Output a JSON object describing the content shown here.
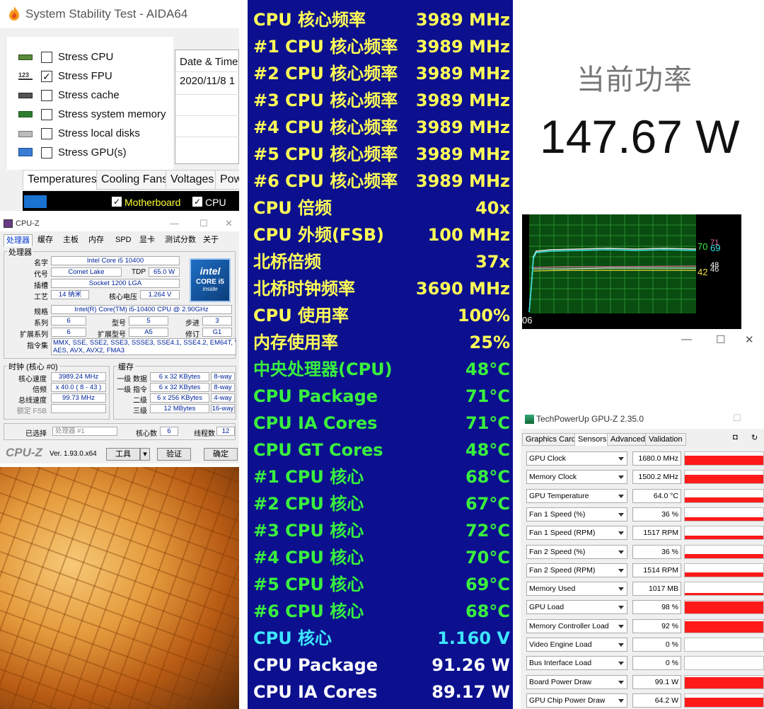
{
  "aida": {
    "title": "System Stability Test - AIDA64",
    "options": [
      {
        "label": "Stress CPU",
        "checked": false,
        "icon": "cpu-chip-icon"
      },
      {
        "label": "Stress FPU",
        "checked": true,
        "icon": "fpu-123-icon"
      },
      {
        "label": "Stress cache",
        "checked": false,
        "icon": "cache-chip-icon"
      },
      {
        "label": "Stress system memory",
        "checked": false,
        "icon": "memory-module-icon"
      },
      {
        "label": "Stress local disks",
        "checked": false,
        "icon": "disk-drive-icon"
      },
      {
        "label": "Stress GPU(s)",
        "checked": false,
        "icon": "monitor-gpu-icon"
      }
    ],
    "date_header": "Date & Time",
    "date_value": "2020/11/8 1",
    "tabs": [
      "Temperatures",
      "Cooling Fans",
      "Voltages",
      "Pow"
    ],
    "graph_checks": [
      "Motherboard",
      "CPU"
    ]
  },
  "cpuz": {
    "title": "CPU-Z",
    "tabs": [
      "处理器",
      "缓存",
      "主板",
      "内存",
      "SPD",
      "显卡",
      "测试分数",
      "关于"
    ],
    "group_processor": "处理器",
    "labels": {
      "name": "名字",
      "codename": "代号",
      "tdp": "TDP",
      "package": "插槽",
      "tech": "工艺",
      "voltage": "核心电压",
      "spec": "规格",
      "family": "系列",
      "model": "型号",
      "stepping": "步进",
      "ext_family": "扩展系列",
      "ext_model": "扩展型号",
      "revision": "修订",
      "instructions": "指令集"
    },
    "values": {
      "name": "Intel Core i5 10400",
      "codename": "Comet Lake",
      "tdp": "65.0 W",
      "package": "Socket 1200 LGA",
      "tech": "14 纳米",
      "voltage": "1.264 V",
      "spec": "Intel(R) Core(TM) i5-10400 CPU @ 2.90GHz",
      "family": "6",
      "model": "5",
      "stepping": "3",
      "ext_family": "6",
      "ext_model": "A5",
      "revision": "G1",
      "instructions_line1": "MMX, SSE, SSE2, SSE3, SSSE3, SSE4.1, SSE4.2, EM64T, VT-x,",
      "instructions_line2": "AES, AVX, AVX2, FMA3"
    },
    "intel_logo": {
      "brand": "intel",
      "line": "CORE i5",
      "sub": "inside"
    },
    "clocks": {
      "group": "时钟 (核心 #0)",
      "core_speed_label": "核心速度",
      "core_speed": "3989.24 MHz",
      "multiplier_label": "倍频",
      "multiplier": "x 40.0 ( 8 - 43 )",
      "bus_label": "总线速度",
      "bus": "99.73 MHz",
      "fsb_label": "额定 FSB"
    },
    "cache": {
      "group": "缓存",
      "l1d_label": "一级 数据",
      "l1d": "6 x 32 KBytes",
      "l1d_way": "8-way",
      "l1i_label": "一级 指令",
      "l1i": "6 x 32 KBytes",
      "l1i_way": "8-way",
      "l2_label": "二级",
      "l2": "6 x 256 KBytes",
      "l2_way": "4-way",
      "l3_label": "三级",
      "l3": "12 MBytes",
      "l3_way": "16-way"
    },
    "footer": {
      "selected_label": "已选择",
      "selected": "处理器 #1",
      "cores_label": "核心数",
      "cores": "6",
      "threads_label": "线程数",
      "threads": "12"
    },
    "brand": "CPU-Z",
    "version": "Ver. 1.93.0.x64",
    "tools_button": "工具",
    "validate_button": "验证",
    "ok_button": "确定"
  },
  "osd": {
    "rows": [
      {
        "k": "CPU 核心频率",
        "v": "3989 MHz",
        "c": "y"
      },
      {
        "k": "#1 CPU 核心频率",
        "v": "3989 MHz",
        "c": "y"
      },
      {
        "k": "#2 CPU 核心频率",
        "v": "3989 MHz",
        "c": "y"
      },
      {
        "k": "#3 CPU 核心频率",
        "v": "3989 MHz",
        "c": "y"
      },
      {
        "k": "#4 CPU 核心频率",
        "v": "3989 MHz",
        "c": "y"
      },
      {
        "k": "#5 CPU 核心频率",
        "v": "3989 MHz",
        "c": "y"
      },
      {
        "k": "#6 CPU 核心频率",
        "v": "3989 MHz",
        "c": "y"
      },
      {
        "k": "CPU 倍频",
        "v": "40x",
        "c": "y"
      },
      {
        "k": "CPU 外频(FSB)",
        "v": "100 MHz",
        "c": "y"
      },
      {
        "k": "北桥倍频",
        "v": "37x",
        "c": "y"
      },
      {
        "k": "北桥时钟频率",
        "v": "3690 MHz",
        "c": "y"
      },
      {
        "k": "CPU 使用率",
        "v": "100%",
        "c": "y"
      },
      {
        "k": "内存使用率",
        "v": "25%",
        "c": "y"
      },
      {
        "k": "中央处理器(CPU)",
        "v": "48°C",
        "c": "g"
      },
      {
        "k": "CPU Package",
        "v": "71°C",
        "c": "g"
      },
      {
        "k": "CPU IA Cores",
        "v": "71°C",
        "c": "g"
      },
      {
        "k": "CPU GT Cores",
        "v": "48°C",
        "c": "g"
      },
      {
        "k": " #1 CPU 核心",
        "v": "68°C",
        "c": "g"
      },
      {
        "k": " #2 CPU 核心",
        "v": "67°C",
        "c": "g"
      },
      {
        "k": " #3 CPU 核心",
        "v": "72°C",
        "c": "g"
      },
      {
        "k": " #4 CPU 核心",
        "v": "70°C",
        "c": "g"
      },
      {
        "k": " #5 CPU 核心",
        "v": "69°C",
        "c": "g"
      },
      {
        "k": " #6 CPU 核心",
        "v": "68°C",
        "c": "g"
      },
      {
        "k": "CPU 核心",
        "v": "1.160 V",
        "c": "c"
      },
      {
        "k": "CPU Package",
        "v": "91.26 W",
        "c": "w"
      },
      {
        "k": "CPU IA Cores",
        "v": "89.17 W",
        "c": "w"
      }
    ]
  },
  "power": {
    "label": "当前功率",
    "value": "147.67 W"
  },
  "graph": {
    "labels": {
      "a": "70",
      "b": "69",
      "c": "71",
      "d": "42",
      "e": "48",
      "f": "46",
      "g": "06"
    }
  },
  "gpuz": {
    "title": "TechPowerUp GPU-Z 2.35.0",
    "tabs": [
      "Graphics Card",
      "Sensors",
      "Advanced",
      "Validation"
    ],
    "sensors": [
      {
        "name": "GPU Clock",
        "value": "1680.0 MHz",
        "level": 0.75
      },
      {
        "name": "Memory Clock",
        "value": "1500.2 MHz",
        "level": 0.7
      },
      {
        "name": "GPU Temperature",
        "value": "64.0 °C",
        "level": 0.35
      },
      {
        "name": "Fan 1 Speed (%)",
        "value": "36 %",
        "level": 0.3
      },
      {
        "name": "Fan 1 Speed (RPM)",
        "value": "1517 RPM",
        "level": 0.3
      },
      {
        "name": "Fan 2 Speed (%)",
        "value": "36 %",
        "level": 0.3
      },
      {
        "name": "Fan 2 Speed (RPM)",
        "value": "1514 RPM",
        "level": 0.3
      },
      {
        "name": "Memory Used",
        "value": "1017 MB",
        "level": 0.2
      },
      {
        "name": "GPU Load",
        "value": "98 %",
        "level": 0.95
      },
      {
        "name": "Memory Controller Load",
        "value": "92 %",
        "level": 0.9
      },
      {
        "name": "Video Engine Load",
        "value": "0 %",
        "level": 0
      },
      {
        "name": "Bus Interface Load",
        "value": "0 %",
        "level": 0
      },
      {
        "name": "Board Power Draw",
        "value": "99.1 W",
        "level": 0.85
      },
      {
        "name": "GPU Chip Power Draw",
        "value": "64.2 W",
        "level": 0.7
      }
    ]
  }
}
